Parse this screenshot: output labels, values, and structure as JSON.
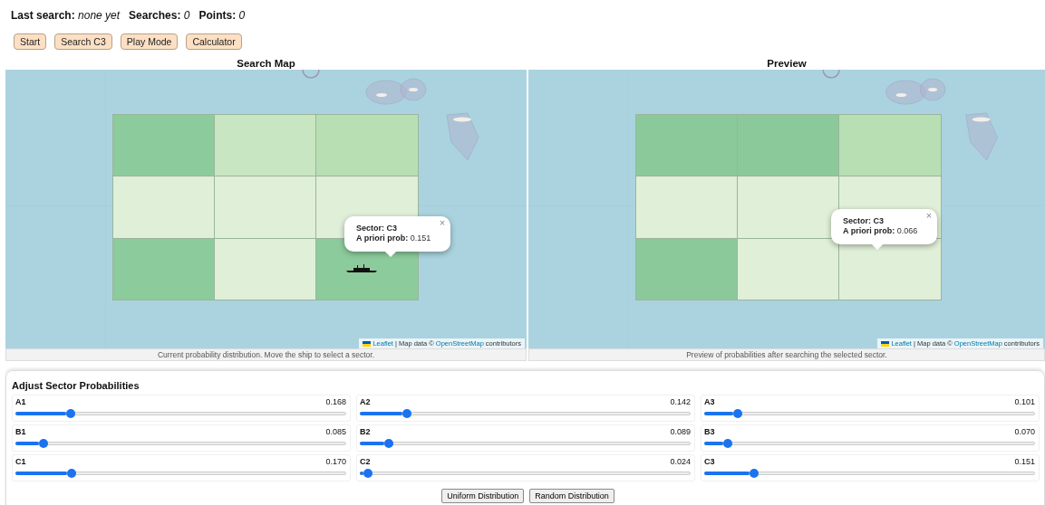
{
  "status": [
    {
      "label": "Last search:",
      "value": "none yet"
    },
    {
      "label": "Searches:",
      "value": "0"
    },
    {
      "label": "Points:",
      "value": "0"
    }
  ],
  "buttons": [
    "Start",
    "Search C3",
    "Play Mode",
    "Calculator"
  ],
  "maps": [
    {
      "title": "Search Map",
      "ship": true,
      "cells": [
        {
          "color": "#8ccb9b"
        },
        {
          "color": "#c8e6c1"
        },
        {
          "color": "#b8dfb3"
        },
        {
          "color": "#e0efd8"
        },
        {
          "color": "#e0efd8"
        },
        {
          "color": "#e0efd8"
        },
        {
          "color": "#8ccb9b"
        },
        {
          "color": "#e0efd8"
        },
        {
          "color": "#8ccb9b"
        }
      ],
      "popup": {
        "sector_label": "Sector:",
        "sector": "C3",
        "prob_label": "A priori prob:",
        "prob": "0.151",
        "close": "×"
      },
      "attribution": {
        "link": "Leaflet",
        "middle": "| Map data ©",
        "source": "OpenStreetMap",
        "end": "contributors"
      },
      "caption": "Current probability distribution. Move the ship to select a sector."
    },
    {
      "title": "Preview",
      "ship": false,
      "cells": [
        {
          "color": "#8cc99a"
        },
        {
          "color": "#8cc99a"
        },
        {
          "color": "#b8dfb3"
        },
        {
          "color": "#e0efd8"
        },
        {
          "color": "#e0efd8"
        },
        {
          "color": "#e0efd8"
        },
        {
          "color": "#8cc99a"
        },
        {
          "color": "#e0efd8"
        },
        {
          "color": "#e0efd8"
        }
      ],
      "popup": {
        "sector_label": "Sector:",
        "sector": "C3",
        "prob_label": "A priori prob:",
        "prob": "0.066",
        "close": "×"
      },
      "attribution": {
        "link": "Leaflet",
        "middle": "| Map data ©",
        "source": "OpenStreetMap",
        "end": "contributors"
      },
      "caption": "Preview of probabilities after searching the selected sector."
    }
  ],
  "panel": {
    "title": "Adjust Sector Probabilities",
    "sliders": [
      {
        "name": "A1",
        "value": "0.168",
        "level": 0.168
      },
      {
        "name": "A2",
        "value": "0.142",
        "level": 0.142
      },
      {
        "name": "A3",
        "value": "0.101",
        "level": 0.101
      },
      {
        "name": "B1",
        "value": "0.085",
        "level": 0.085
      },
      {
        "name": "B2",
        "value": "0.089",
        "level": 0.089
      },
      {
        "name": "B3",
        "value": "0.070",
        "level": 0.07
      },
      {
        "name": "C1",
        "value": "0.170",
        "level": 0.17
      },
      {
        "name": "C2",
        "value": "0.024",
        "level": 0.024
      },
      {
        "name": "C3",
        "value": "0.151",
        "level": 0.151
      }
    ],
    "buttons": [
      "Uniform Distribution",
      "Random Distribution"
    ]
  }
}
